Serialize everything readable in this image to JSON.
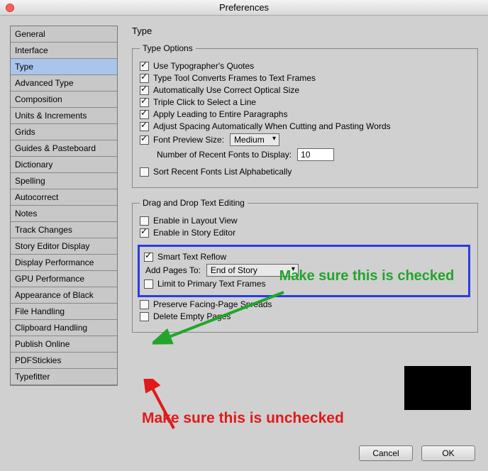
{
  "window": {
    "title": "Preferences"
  },
  "sidebar": {
    "items": [
      {
        "label": "General"
      },
      {
        "label": "Interface"
      },
      {
        "label": "Type",
        "selected": true
      },
      {
        "label": "Advanced Type"
      },
      {
        "label": "Composition"
      },
      {
        "label": "Units & Increments"
      },
      {
        "label": "Grids"
      },
      {
        "label": "Guides & Pasteboard"
      },
      {
        "label": "Dictionary"
      },
      {
        "label": "Spelling"
      },
      {
        "label": "Autocorrect"
      },
      {
        "label": "Notes"
      },
      {
        "label": "Track Changes"
      },
      {
        "label": "Story Editor Display"
      },
      {
        "label": "Display Performance"
      },
      {
        "label": "GPU Performance"
      },
      {
        "label": "Appearance of Black"
      },
      {
        "label": "File Handling"
      },
      {
        "label": "Clipboard Handling"
      },
      {
        "label": "Publish Online"
      },
      {
        "label": "PDFStickies"
      },
      {
        "label": "Typefitter"
      }
    ]
  },
  "panel": {
    "heading": "Type",
    "typeOptions": {
      "legend": "Type Options",
      "quotes": {
        "label": "Use Typographer's Quotes",
        "checked": true
      },
      "convert": {
        "label": "Type Tool Converts Frames to Text Frames",
        "checked": true
      },
      "optical": {
        "label": "Automatically Use Correct Optical Size",
        "checked": true
      },
      "triple": {
        "label": "Triple Click to Select a Line",
        "checked": true
      },
      "leading": {
        "label": "Apply Leading to Entire Paragraphs",
        "checked": true
      },
      "spacing": {
        "label": "Adjust Spacing Automatically When Cutting and Pasting Words",
        "checked": true
      },
      "previewLabel": "Font Preview Size:",
      "previewChecked": true,
      "previewValue": "Medium",
      "recentLabel": "Number of Recent Fonts to Display:",
      "recentValue": "10",
      "sortRecent": {
        "label": "Sort Recent Fonts List Alphabetically",
        "checked": false
      }
    },
    "dragDrop": {
      "legend": "Drag and Drop Text Editing",
      "layout": {
        "label": "Enable in Layout View",
        "checked": false
      },
      "story": {
        "label": "Enable in Story Editor",
        "checked": true
      }
    },
    "reflow": {
      "legend": "Smart Text Reflow",
      "enabled": true,
      "addPagesLabel": "Add Pages To:",
      "addPagesValue": "End of Story",
      "limit": {
        "label": "Limit to Primary Text Frames",
        "checked": false
      },
      "facing": {
        "label": "Preserve Facing-Page Spreads",
        "checked": false
      },
      "delete": {
        "label": "Delete Empty Pages",
        "checked": false
      }
    }
  },
  "annotations": {
    "green": "Make sure this is checked",
    "red": "Make sure this is unchecked"
  },
  "buttons": {
    "cancel": "Cancel",
    "ok": "OK"
  }
}
